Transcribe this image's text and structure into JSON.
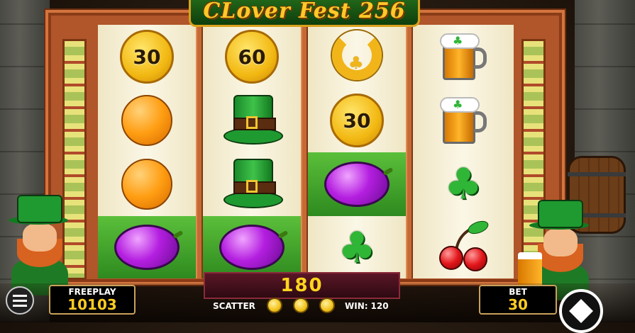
{
  "title": "CLover Fest 256",
  "reels": [
    [
      "coin-30",
      "orange",
      "orange",
      "plum"
    ],
    [
      "coin-60",
      "leprechaun-hat",
      "leprechaun-hat",
      "plum"
    ],
    [
      "horseshoe",
      "coin-30",
      "plum",
      "clover"
    ],
    [
      "beer-mug",
      "beer-mug",
      "clover",
      "cherries"
    ]
  ],
  "coin_values": {
    "r0": "30",
    "r1": "60",
    "r2": "30"
  },
  "winning_cells": [
    [
      0,
      3
    ],
    [
      1,
      3
    ],
    [
      2,
      2
    ]
  ],
  "win_display": "180",
  "freeplay": {
    "label": "FREEPLAY",
    "value": "10103"
  },
  "bet": {
    "label": "BET",
    "value": "30"
  },
  "scatter": {
    "label": "SCATTER",
    "count": 3
  },
  "win": {
    "label": "WIN:",
    "value": "120"
  },
  "colors": {
    "win_highlight": "#4aad2e",
    "value_gold": "#ffcc22",
    "title_gold": "#ffc928"
  }
}
